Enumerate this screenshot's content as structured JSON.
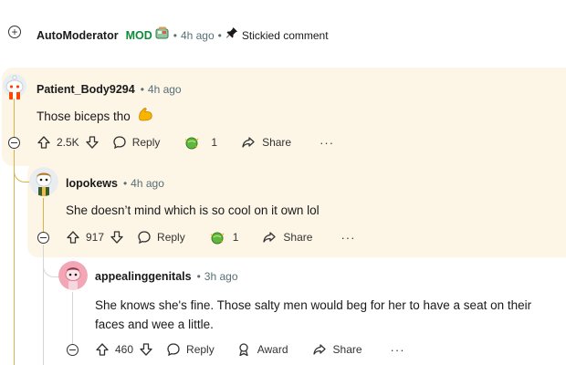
{
  "automod": {
    "username": "AutoModerator",
    "mod_label": "MOD",
    "time": "4h ago",
    "stickied": "Stickied comment"
  },
  "comments": [
    {
      "username": "Patient_Body9294",
      "time": "4h ago",
      "body": "Those biceps tho",
      "votes": "2.5K",
      "reply": "Reply",
      "award_count": "1",
      "share": "Share",
      "more": "···"
    },
    {
      "username": "lopokews",
      "time": "4h ago",
      "body": "She doesn’t mind which is so cool on it own lol",
      "votes": "917",
      "reply": "Reply",
      "award_count": "1",
      "share": "Share",
      "more": "···"
    },
    {
      "username": "appealinggenitals",
      "time": "3h ago",
      "body_line1": "She knows she's  fine. Those salty men would beg for her to have a seat on their",
      "body_line2": "faces and wee a little.",
      "votes": "460",
      "reply": "Reply",
      "award": "Award",
      "share": "Share",
      "more": "···"
    }
  ],
  "icons": [
    "plus-circle-icon",
    "bot-badge-icon",
    "pin-icon",
    "upvote-icon",
    "downvote-icon",
    "reply-icon",
    "award-icon",
    "share-icon",
    "collapse-icon",
    "flexed-biceps-emoji"
  ],
  "colors": {
    "highlight_bg": "#fdf6e7",
    "thread_gold": "#d9b34a",
    "mod_green": "#0f8a3b",
    "meta_gray": "#576f76"
  }
}
